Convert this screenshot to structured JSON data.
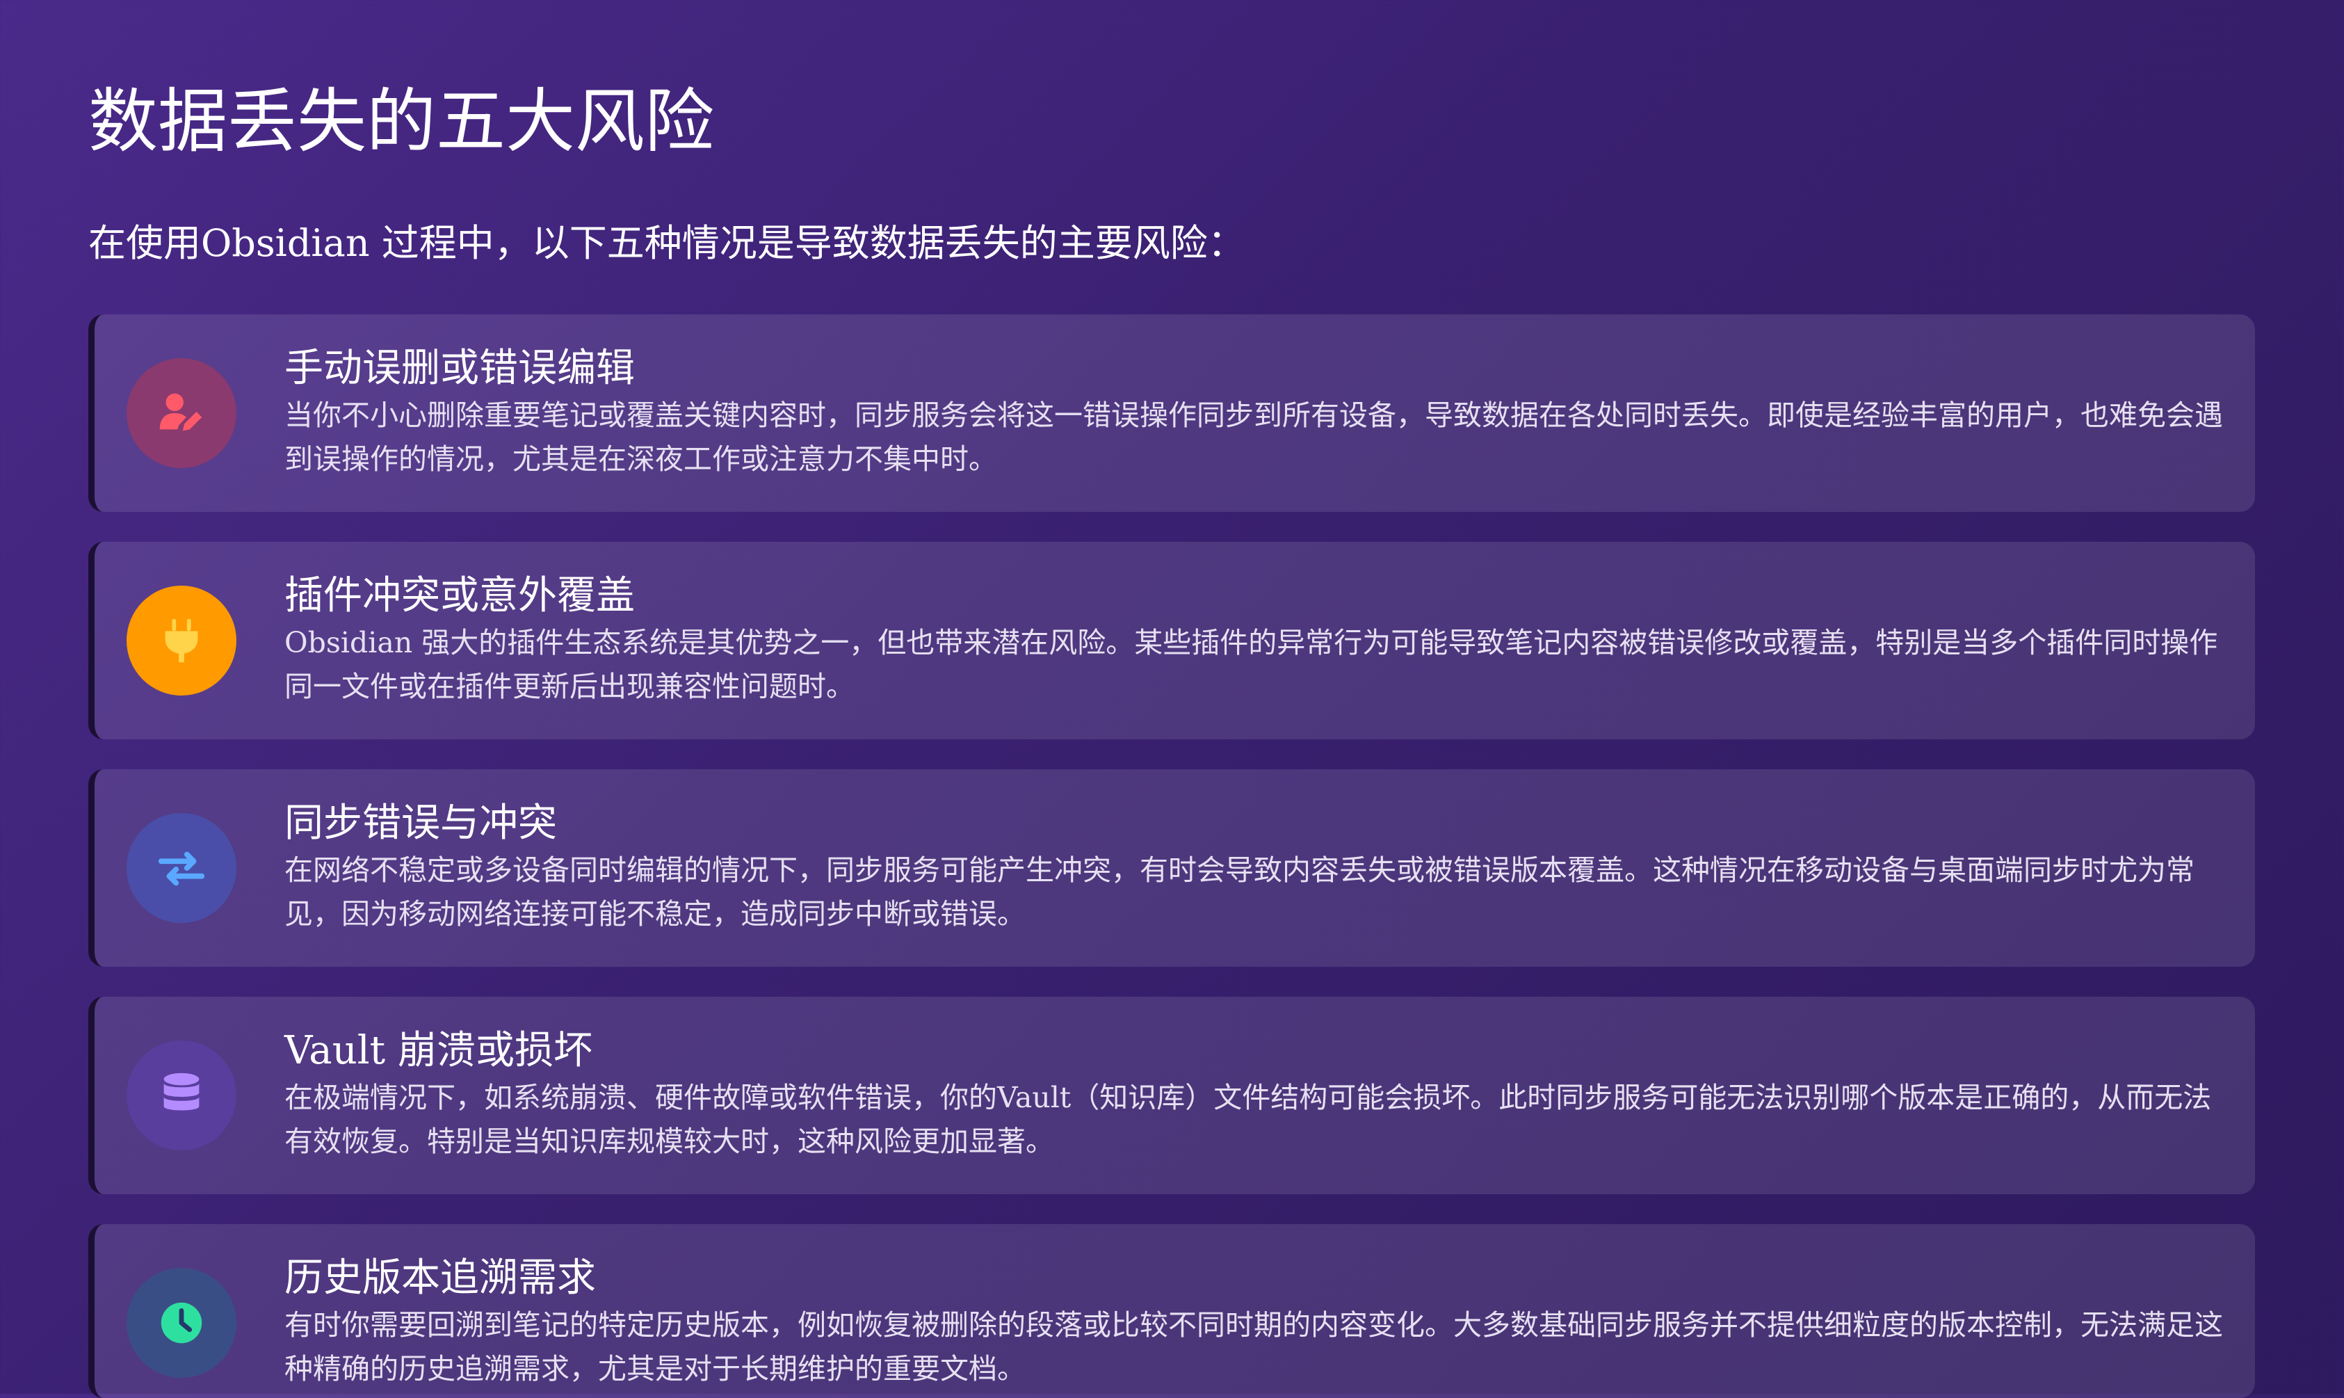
{
  "page": {
    "title": "数据丢失的五大风险",
    "subtitle": "在使用Obsidian 过程中，以下五种情况是导致数据丢失的主要风险："
  },
  "risks": [
    {
      "icon": "user-edit-icon",
      "icon_bg": "#8a3a6e",
      "icon_color": "#ff5a6a",
      "title": "手动误删或错误编辑",
      "text": "当你不小心删除重要笔记或覆盖关键内容时，同步服务会将这一错误操作同步到所有设备，导致数据在各处同时丢失。即使是经验丰富的用户，也难免会遇到误操作的情况，尤其是在深夜工作或注意力不集中时。"
    },
    {
      "icon": "plug-icon",
      "icon_bg": "#ff9a00",
      "icon_color": "#ffd34a",
      "title": "插件冲突或意外覆盖",
      "text": "Obsidian 强大的插件生态系统是其优势之一，但也带来潜在风险。某些插件的异常行为可能导致笔记内容被错误修改或覆盖，特别是当多个插件同时操作同一文件或在插件更新后出现兼容性问题时。"
    },
    {
      "icon": "sync-arrows-icon",
      "icon_bg": "#4a4ea8",
      "icon_color": "#5aa8ff",
      "title": "同步错误与冲突",
      "text": "在网络不稳定或多设备同时编辑的情况下，同步服务可能产生冲突，有时会导致内容丢失或被错误版本覆盖。这种情况在移动设备与桌面端同步时尤为常见，因为移动网络连接可能不稳定，造成同步中断或错误。"
    },
    {
      "icon": "database-icon",
      "icon_bg": "#5a3e9e",
      "icon_color": "#b48cff",
      "title": "Vault 崩溃或损坏",
      "text": "在极端情况下，如系统崩溃、硬件故障或软件错误，你的Vault（知识库）文件结构可能会损坏。此时同步服务可能无法识别哪个版本是正确的，从而无法有效恢复。特别是当知识库规模较大时，这种风险更加显著。"
    },
    {
      "icon": "clock-icon",
      "icon_bg": "#3a4e86",
      "icon_color": "#2ee0a0",
      "title": "历史版本追溯需求",
      "text": "有时你需要回溯到笔记的特定历史版本，例如恢复被删除的段落或比较不同时期的内容变化。大多数基础同步服务并不提供细粒度的版本控制，无法满足这种精确的历史追溯需求，尤其是对于长期维护的重要文档。"
    }
  ]
}
